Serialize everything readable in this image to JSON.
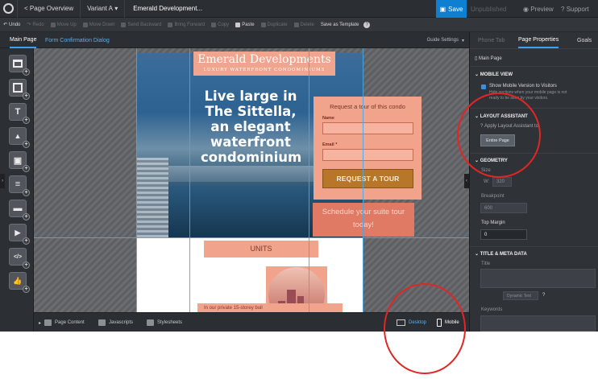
{
  "topbar": {
    "page_overview": "< Page Overview",
    "variant": "Variant A",
    "page_title": "Emerald Development...",
    "save": "Save",
    "unpublished": "Unpublished",
    "preview": "Preview",
    "support": "Support"
  },
  "toolbar": {
    "undo": "Undo",
    "redo": "Redo",
    "move_up": "Move Up",
    "move_down": "Move Down",
    "send_backward": "Send Backward",
    "bring_forward": "Bring Forward",
    "copy": "Copy",
    "paste": "Paste",
    "duplicate": "Duplicate",
    "delete": "Delete",
    "save_as_template": "Save as Template"
  },
  "tabs": {
    "main_page": "Main Page",
    "form_confirmation": "Form Confirmation Dialog",
    "guide_settings": "Guide Settings"
  },
  "widgets": [
    {
      "name": "section-widget-icon",
      "glyph": ""
    },
    {
      "name": "box-widget-icon",
      "glyph": ""
    },
    {
      "name": "text-widget-icon",
      "glyph": "T"
    },
    {
      "name": "image-widget-icon",
      "glyph": "▲"
    },
    {
      "name": "image-gallery-widget-icon",
      "glyph": "▣"
    },
    {
      "name": "form-widget-icon",
      "glyph": "≡"
    },
    {
      "name": "button-widget-icon",
      "glyph": "▬"
    },
    {
      "name": "video-widget-icon",
      "glyph": "▶"
    },
    {
      "name": "custom-html-widget-icon",
      "glyph": "</>"
    },
    {
      "name": "social-widget-icon",
      "glyph": "👍"
    }
  ],
  "canvas": {
    "brand_name": "Emerald Developments",
    "brand_sub": "LUXURY WATERFRONT CONDOMINIUMS",
    "hero_heading": "Live large in\nThe Sittella,\nan elegant\nwaterfront\ncondominium",
    "form_heading": "Request a tour of this condo",
    "name_label": "Name",
    "email_label": "Email *",
    "cta_button": "REQUEST A TOUR",
    "tour_text": "Schedule your suite tour\ntoday!",
    "units": "UNITS",
    "paragraph": "In our private 15-storey buil"
  },
  "bottombar": {
    "page_content": "Page Content",
    "javascripts": "Javascripts",
    "stylesheets": "Stylesheets",
    "desktop": "Desktop",
    "mobile": "Mobile"
  },
  "panel": {
    "tab_phone": "Phone Tab",
    "tab_properties": "Page Properties",
    "tab_goals": "Goals",
    "main_page": "Main Page",
    "mobile_view_head": "MOBILE VIEW",
    "show_mobile": "Show Mobile Version to Visitors",
    "mobile_hint_1": "Hide sections when your mobile page is not",
    "mobile_hint_2": "ready to be seen by your visitors.",
    "layout_head": "LAYOUT ASSISTANT",
    "apply_layout": "Apply Layout Assistant to:",
    "entire_page": "Entire Page",
    "geometry_head": "GEOMETRY",
    "size_label": "Size",
    "width_label": "W:",
    "width_value": "320",
    "breakpoint_label": "Breakpoint",
    "breakpoint_value": "600",
    "top_margin_label": "Top Margin",
    "top_margin_value": "0",
    "title_meta_head": "TITLE & META DATA",
    "title_label": "Title",
    "dynamic_text": "Dynamic Text",
    "keywords_label": "Keywords"
  },
  "colors": {
    "save_blue": "#0f7fd1",
    "accent_blue": "#3da0f0",
    "salmon": "#f2a38c",
    "cta_gold": "#b8762b",
    "annotation_red": "#e12625"
  }
}
